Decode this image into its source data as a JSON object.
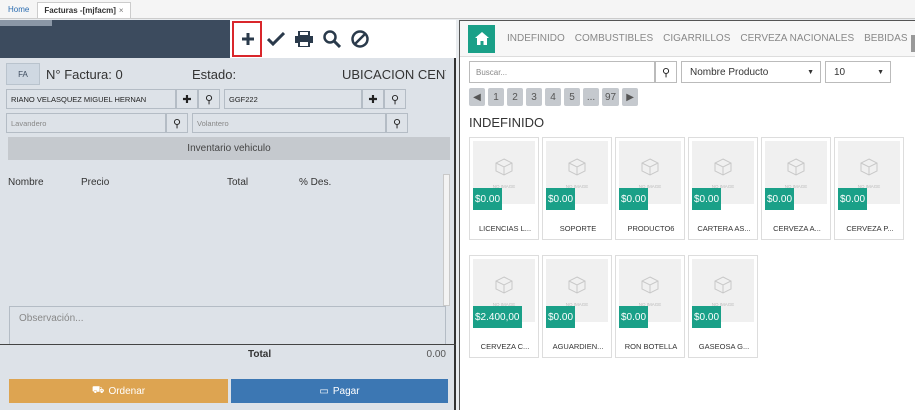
{
  "tabs": {
    "home": "Home",
    "doc": "Facturas -[mjfacm]",
    "close": "×"
  },
  "invoice": {
    "fa": "FA",
    "number_label": "N° Factura: 0",
    "status_label": "Estado:",
    "location_label": "UBICACION CENT",
    "client": "RIANO VELASQUEZ MIGUEL HERNAN",
    "plate": "GGF222",
    "washer_placeholder": "Lavandero",
    "driver_placeholder": "Volantero",
    "inventory_label": "Inventario vehiculo",
    "columns": [
      "Nombre",
      "Precio",
      "Total",
      "% Des."
    ],
    "observation_placeholder": "Observación...",
    "total_label": "Total",
    "total_value": "0.00",
    "order_label": "Ordenar",
    "pay_label": "Pagar"
  },
  "toolbar": {
    "icons": [
      "plus-icon",
      "check-icon",
      "print-icon",
      "search-icon",
      "ban-icon"
    ]
  },
  "catalog": {
    "categories": [
      "INDEFINIDO",
      "COMBUSTIBLES",
      "CIGARRILLOS",
      "CERVEZA NACIONALES",
      "BEBIDAS"
    ],
    "search_placeholder": "Buscar...",
    "sort_value": "Nombre Producto",
    "page_size": "10",
    "pages": [
      "1",
      "2",
      "3",
      "4",
      "5",
      "...",
      "97"
    ],
    "section_title": "INDEFINIDO",
    "no_image_text": "NO IMAGE",
    "products": [
      {
        "name": "LICENCIAS L...",
        "price": "$0.00"
      },
      {
        "name": "SOPORTE",
        "price": "$0.00"
      },
      {
        "name": "PRODUCTO6",
        "price": "$0.00"
      },
      {
        "name": "CARTERA AS...",
        "price": "$0.00"
      },
      {
        "name": "CERVEZA A...",
        "price": "$0.00"
      },
      {
        "name": "CERVEZA P...",
        "price": "$0.00"
      },
      {
        "name": "CERVEZA C...",
        "price": "$2.400,00"
      },
      {
        "name": "AGUARDIEN...",
        "price": "$0.00"
      },
      {
        "name": "RON BOTELLA",
        "price": "$0.00"
      },
      {
        "name": "GASEOSA G...",
        "price": "$0.00"
      }
    ]
  },
  "colors": {
    "accent": "#1aa088",
    "order": "#dda451",
    "pay": "#3c77b3",
    "header": "#3c4b5e",
    "highlight": "#d9262b"
  }
}
